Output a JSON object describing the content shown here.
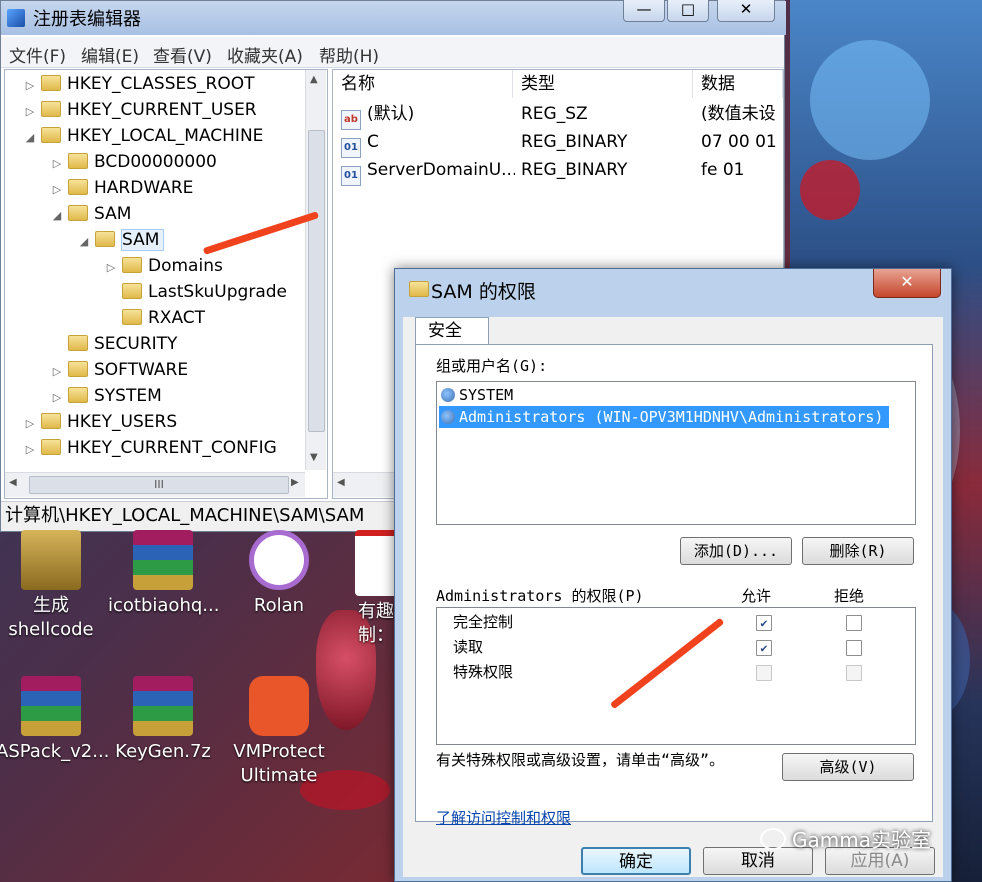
{
  "regedit": {
    "title": "注册表编辑器",
    "window_buttons": [
      "—",
      "□",
      "✕"
    ],
    "menu": [
      "文件(F)",
      "编辑(E)",
      "查看(V)",
      "收藏夹(A)",
      "帮助(H)"
    ],
    "tree": [
      {
        "label": "HKEY_CLASSES_ROOT",
        "expander": "▷"
      },
      {
        "label": "HKEY_CURRENT_USER",
        "expander": "▷"
      },
      {
        "label": "HKEY_LOCAL_MACHINE",
        "expander": "◢"
      },
      {
        "label": "BCD00000000",
        "expander": "▷"
      },
      {
        "label": "HARDWARE",
        "expander": "▷"
      },
      {
        "label": "SAM",
        "expander": "◢"
      },
      {
        "label": "SAM",
        "expander": "◢",
        "selected": true
      },
      {
        "label": "Domains",
        "expander": "▷"
      },
      {
        "label": "LastSkuUpgrade",
        "expander": ""
      },
      {
        "label": "RXACT",
        "expander": ""
      },
      {
        "label": "SECURITY",
        "expander": ""
      },
      {
        "label": "SOFTWARE",
        "expander": "▷"
      },
      {
        "label": "SYSTEM",
        "expander": "▷"
      },
      {
        "label": "HKEY_USERS",
        "expander": "▷"
      },
      {
        "label": "HKEY_CURRENT_CONFIG",
        "expander": "▷"
      }
    ],
    "columns": [
      "名称",
      "类型",
      "数据"
    ],
    "values": [
      {
        "icon": "ab",
        "name": "(默认)",
        "type": "REG_SZ",
        "data": "(数值未设"
      },
      {
        "icon": "01",
        "name": "C",
        "type": "REG_BINARY",
        "data": "07 00 01"
      },
      {
        "icon": "01",
        "name": "ServerDomainU...",
        "type": "REG_BINARY",
        "data": "fe 01"
      }
    ],
    "status_path": "计算机\\HKEY_LOCAL_MACHINE\\SAM\\SAM",
    "scroll_glyph": "III"
  },
  "desktop_icons": [
    {
      "label": "生成\nshellcode"
    },
    {
      "label": "icotbiaohq..."
    },
    {
      "label": "Rolan"
    },
    {
      "label": "有趣的\n制：软"
    },
    {
      "label": "ASPack_v2..."
    },
    {
      "label": "KeyGen.7z"
    },
    {
      "label": "VMProtect\nUltimate"
    }
  ],
  "dialog": {
    "title": "SAM 的权限",
    "close_label": "✕",
    "tab": "安全",
    "group_label": "组或用户名(G):",
    "users": [
      {
        "name": "SYSTEM",
        "selected": false
      },
      {
        "name": "Administrators (WIN-OPV3M1HDNHV\\Administrators)",
        "selected": true
      }
    ],
    "add_button": "添加(D)...",
    "remove_button": "删除(R)",
    "perm_label": "Administrators 的权限(P)",
    "allow_header": "允许",
    "deny_header": "拒绝",
    "permissions": [
      {
        "name": "完全控制",
        "allow": true,
        "deny": false,
        "disabled": false
      },
      {
        "name": "读取",
        "allow": true,
        "deny": false,
        "disabled": false
      },
      {
        "name": "特殊权限",
        "allow": false,
        "deny": false,
        "disabled": true
      }
    ],
    "advanced_text": "有关特殊权限或高级设置，请单击“高级”。",
    "advanced_button": "高级(V)",
    "help_link": "了解访问控制和权限",
    "ok_button": "确定",
    "cancel_button": "取消",
    "apply_button": "应用(A)"
  },
  "watermark": "Gamma实验室",
  "accent": "#f0421c"
}
